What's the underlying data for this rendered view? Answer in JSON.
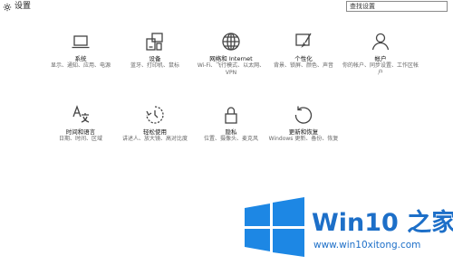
{
  "header": {
    "title": "设置",
    "search_placeholder": "查找设置"
  },
  "tiles": [
    {
      "title": "系统",
      "desc": "显示、通知、应用、电源",
      "icon": "laptop-icon"
    },
    {
      "title": "设备",
      "desc": "蓝牙、打印机、鼠标",
      "icon": "devices-icon"
    },
    {
      "title": "网络和 Internet",
      "desc": "Wi-Fi、飞行模式、以太网、VPN",
      "icon": "globe-icon"
    },
    {
      "title": "个性化",
      "desc": "背景、锁屏、颜色、声音",
      "icon": "personalization-icon"
    },
    {
      "title": "帐户",
      "desc": "你的帐户、同步设置、工作区帐户",
      "icon": "person-icon"
    },
    {
      "title": "时间和语言",
      "desc": "日期、时间、区域",
      "icon": "time-language-icon"
    },
    {
      "title": "轻松使用",
      "desc": "讲述人、放大镜、高对比度",
      "icon": "ease-of-access-icon"
    },
    {
      "title": "隐私",
      "desc": "位置、摄像头、麦克风",
      "icon": "lock-icon"
    },
    {
      "title": "更新和恢复",
      "desc": "Windows 更新、备份、恢复",
      "icon": "update-icon"
    }
  ],
  "watermark": {
    "title": "Win10 之家",
    "url": "www.win10xitong.com"
  },
  "colors": {
    "brand_blue": "#1d6fc8",
    "icon_stroke": "#444444",
    "desc_text": "#666666"
  }
}
